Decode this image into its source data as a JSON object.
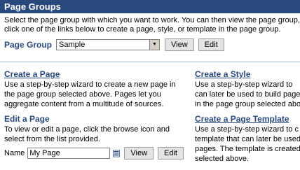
{
  "header": {
    "title": "Page Groups"
  },
  "intro": {
    "line1": "Select the page group with which you want to work. You can then view the page group,",
    "line2": "click one of the links below to create a page, style, or template in the page group."
  },
  "page_group": {
    "label": "Page Group",
    "selected": "Sample",
    "view_label": "View",
    "edit_label": "Edit"
  },
  "create_page": {
    "title": "Create a Page",
    "lines": [
      "Use a step-by-step wizard to create a new page in",
      "the page group selected above. Pages let you",
      "aggregate content from a multitude of sources."
    ]
  },
  "edit_page": {
    "title": "Edit a Page",
    "lines": [
      "To view or edit a page, click the browse icon and",
      "select from the list provided."
    ],
    "name_label": "Name",
    "name_value": "My Page",
    "view_label": "View",
    "edit_label": "Edit"
  },
  "create_style": {
    "title": "Create a Style",
    "lines": [
      "Use a step-by-step wizard to",
      "can later be used to build pages",
      "in the page group selected above"
    ]
  },
  "create_template": {
    "title": "Create a Page Template",
    "lines": [
      "Use a step-by-step wizard to c",
      "template that can later be used",
      "pages. The template is created",
      "selected above."
    ]
  },
  "colors": {
    "header_bg": "#2a4a7d",
    "link": "#2a4a7d",
    "rule": "#a6b6cc"
  }
}
